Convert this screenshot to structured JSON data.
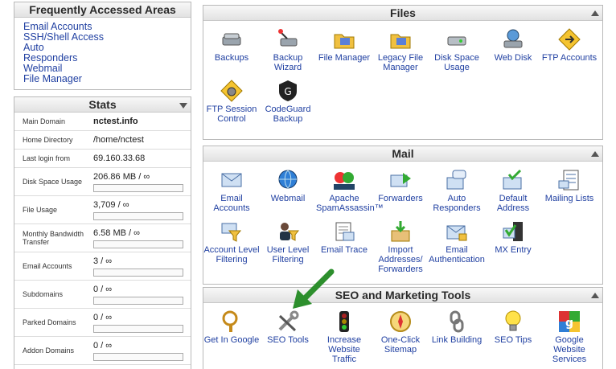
{
  "freq": {
    "title": "Frequently Accessed Areas",
    "links": [
      "Email Accounts",
      "SSH/Shell Access",
      "Auto",
      "Responders",
      "Webmail",
      "File Manager"
    ]
  },
  "stats": {
    "title": "Stats",
    "main_domain": {
      "label": "Main Domain",
      "value": "nctest.info"
    },
    "home_dir": {
      "label": "Home Directory",
      "value": "/home/nctest"
    },
    "last_login": {
      "label": "Last login from",
      "value": "69.160.33.68"
    },
    "disk": {
      "label": "Disk Space Usage",
      "value": "206.86 MB / ∞"
    },
    "file_usage": {
      "label": "File Usage",
      "value": "3,709 / ∞"
    },
    "bandwidth": {
      "label": "Monthly Bandwidth Transfer",
      "value": "6.58 MB / ∞"
    },
    "email_accounts": {
      "label": "Email Accounts",
      "value": "3 / ∞"
    },
    "subdomains": {
      "label": "Subdomains",
      "value": "0 / ∞"
    },
    "parked": {
      "label": "Parked Domains",
      "value": "0 / ∞"
    },
    "addon": {
      "label": "Addon Domains",
      "value": "0 / ∞"
    }
  },
  "files": {
    "title": "Files",
    "items": [
      {
        "label": "Backups",
        "icon": "backups-icon"
      },
      {
        "label": "Backup Wizard",
        "icon": "backup-wizard-icon"
      },
      {
        "label": "File Manager",
        "icon": "folder-icon"
      },
      {
        "label": "Legacy File Manager",
        "icon": "folder-icon"
      },
      {
        "label": "Disk Space Usage",
        "icon": "disk-icon"
      },
      {
        "label": "Web Disk",
        "icon": "web-disk-icon"
      },
      {
        "label": "FTP Accounts",
        "icon": "ftp-icon"
      },
      {
        "label": "FTP Session Control",
        "icon": "ftp-session-icon"
      },
      {
        "label": "CodeGuard Backup",
        "icon": "codeguard-icon"
      }
    ]
  },
  "mail": {
    "title": "Mail",
    "items": [
      {
        "label": "Email Accounts",
        "icon": "envelope-icon"
      },
      {
        "label": "Webmail",
        "icon": "globe-mail-icon"
      },
      {
        "label": "Apache SpamAssassin™",
        "icon": "spamassassin-icon"
      },
      {
        "label": "Forwarders",
        "icon": "forward-mail-icon"
      },
      {
        "label": "Auto Responders",
        "icon": "auto-responder-icon"
      },
      {
        "label": "Default Address",
        "icon": "default-address-icon"
      },
      {
        "label": "Mailing Lists",
        "icon": "mailing-list-icon"
      },
      {
        "label": "Account Level Filtering",
        "icon": "filter-icon"
      },
      {
        "label": "User Level Filtering",
        "icon": "user-filter-icon"
      },
      {
        "label": "Email Trace",
        "icon": "trace-icon"
      },
      {
        "label": "Import Addresses/ Forwarders",
        "icon": "import-icon"
      },
      {
        "label": "Email Authentication",
        "icon": "auth-icon"
      },
      {
        "label": "MX Entry",
        "icon": "mx-icon"
      }
    ]
  },
  "seo": {
    "title": "SEO and Marketing Tools",
    "items": [
      {
        "label": "Get In Google",
        "icon": "magnifier-icon"
      },
      {
        "label": "SEO Tools",
        "icon": "tools-icon"
      },
      {
        "label": "Increase Website Traffic",
        "icon": "traffic-light-icon"
      },
      {
        "label": "One-Click Sitemap",
        "icon": "compass-icon"
      },
      {
        "label": "Link Building",
        "icon": "chain-icon"
      },
      {
        "label": "SEO Tips",
        "icon": "lightbulb-icon"
      },
      {
        "label": "Google Website Services",
        "icon": "google-icon"
      }
    ]
  }
}
